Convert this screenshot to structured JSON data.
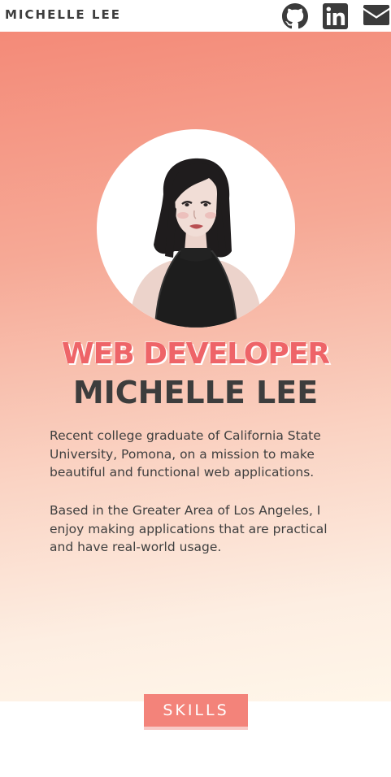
{
  "header": {
    "brand": "MICHELLE LEE",
    "icons": [
      "github-icon",
      "linkedin-icon",
      "mail-icon"
    ]
  },
  "hero": {
    "role": "WEB DEVELOPER",
    "name": "MICHELLE LEE",
    "bio_1": "Recent college graduate of California State University, Pomona, on a mission to make beautiful and functional web applications.",
    "bio_2": "Based in the Greater Area of Los Angeles, I enjoy making applications that are practical and have real-world usage."
  },
  "nav": {
    "skills_label": "SKILLS"
  },
  "colors": {
    "accent": "#ee6468",
    "text_dark": "#3d3d3d",
    "tab_bg": "#f3837a",
    "gradient_top": "#f48a78",
    "gradient_bottom": "#fff6e9"
  }
}
